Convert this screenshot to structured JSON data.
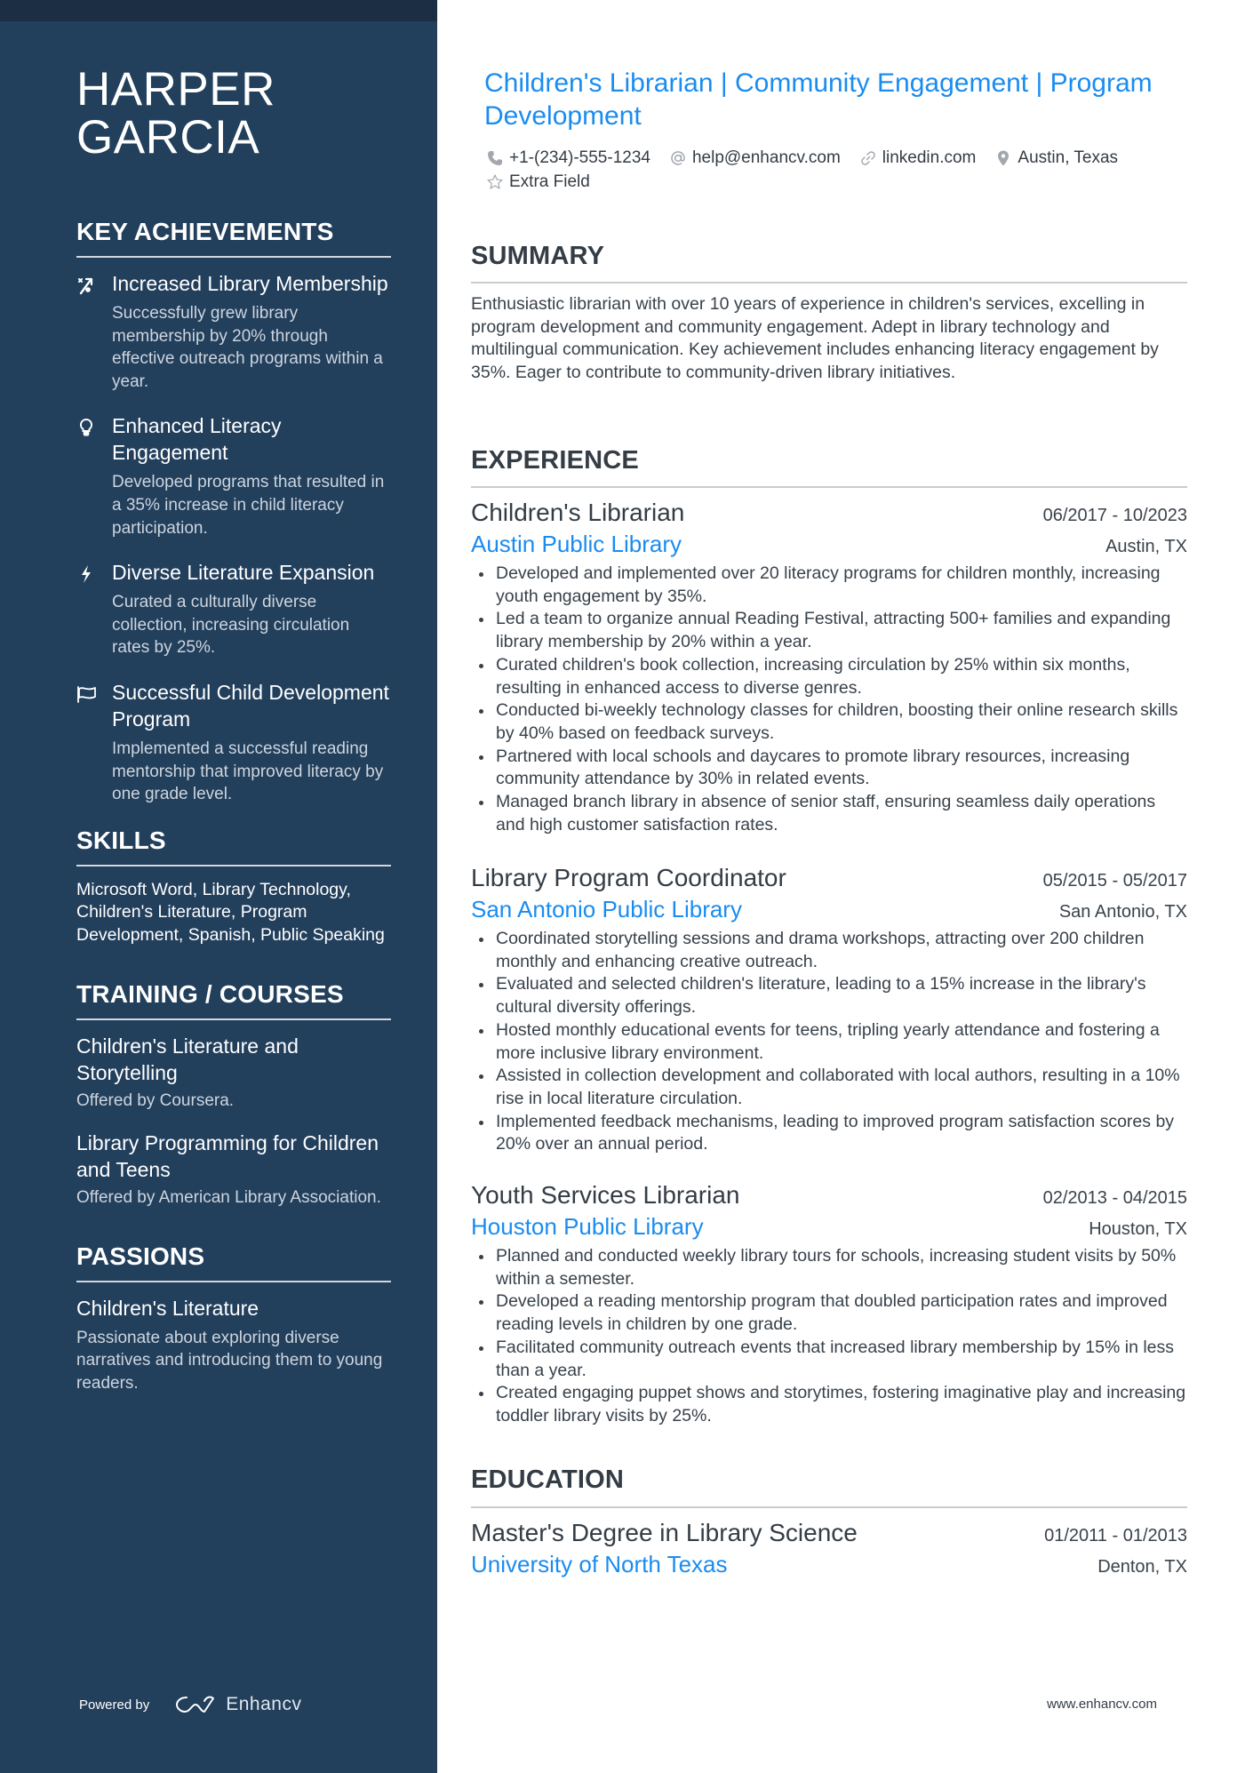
{
  "profile": {
    "first_name": "HARPER",
    "last_name": "GARCIA",
    "headline": "Children's Librarian | Community Engagement | Program Development"
  },
  "contacts": {
    "phone": "+1-(234)-555-1234",
    "email": "help@enhancv.com",
    "link": "linkedin.com",
    "location": "Austin, Texas",
    "extra": "Extra Field"
  },
  "colors": {
    "sidebar_bg": "#223f5c",
    "sidebar_topbar": "#1c2e44",
    "accent": "#1a8cf0",
    "text": "#343c45"
  },
  "sidebar": {
    "achievements": {
      "heading": "KEY ACHIEVEMENTS",
      "items": [
        {
          "icon": "growth-chart-icon",
          "title": "Increased Library Membership",
          "desc": "Successfully grew library membership by 20% through effective outreach programs within a year."
        },
        {
          "icon": "lightbulb-icon",
          "title": "Enhanced Literacy Engagement",
          "desc": "Developed programs that resulted in a 35% increase in child literacy participation."
        },
        {
          "icon": "lightning-bolt-icon",
          "title": "Diverse Literature Expansion",
          "desc": "Curated a culturally diverse collection, increasing circulation rates by 25%."
        },
        {
          "icon": "flag-icon",
          "title": "Successful Child Development Program",
          "desc": "Implemented a successful reading mentorship that improved literacy by one grade level."
        }
      ]
    },
    "skills": {
      "heading": "SKILLS",
      "text": "Microsoft Word, Library Technology, Children's Literature, Program Development, Spanish, Public Speaking"
    },
    "training": {
      "heading": "TRAINING / COURSES",
      "items": [
        {
          "title": "Children's Literature and Storytelling",
          "desc": "Offered by Coursera."
        },
        {
          "title": "Library Programming for Children and Teens",
          "desc": "Offered by American Library Association."
        }
      ]
    },
    "passions": {
      "heading": "PASSIONS",
      "items": [
        {
          "title": "Children's Literature",
          "desc": "Passionate about exploring diverse narratives and introducing them to young readers."
        }
      ]
    },
    "powered_by": {
      "label": "Powered by",
      "brand": "Enhancv"
    }
  },
  "summary": {
    "heading": "SUMMARY",
    "text": "Enthusiastic librarian with over 10 years of experience in children's services, excelling in program development and community engagement. Adept in library technology and multilingual communication. Key achievement includes enhancing literacy engagement by 35%. Eager to contribute to community-driven library initiatives."
  },
  "experience": {
    "heading": "EXPERIENCE",
    "jobs": [
      {
        "title": "Children's Librarian",
        "dates": "06/2017 - 10/2023",
        "org": "Austin Public Library",
        "location": "Austin, TX",
        "bullets": [
          "Developed and implemented over 20 literacy programs for children monthly, increasing youth engagement by 35%.",
          "Led a team to organize annual Reading Festival, attracting 500+ families and expanding library membership by 20% within a year.",
          "Curated children's book collection, increasing circulation by 25% within six months, resulting in enhanced access to diverse genres.",
          "Conducted bi-weekly technology classes for children, boosting their online research skills by 40% based on feedback surveys.",
          "Partnered with local schools and daycares to promote library resources, increasing community attendance by 30% in related events.",
          "Managed branch library in absence of senior staff, ensuring seamless daily operations and high customer satisfaction rates."
        ]
      },
      {
        "title": "Library Program Coordinator",
        "dates": "05/2015 - 05/2017",
        "org": "San Antonio Public Library",
        "location": "San Antonio, TX",
        "bullets": [
          "Coordinated storytelling sessions and drama workshops, attracting over 200 children monthly and enhancing creative outreach.",
          "Evaluated and selected children's literature, leading to a 15% increase in the library's cultural diversity offerings.",
          "Hosted monthly educational events for teens, tripling yearly attendance and fostering a more inclusive library environment.",
          "Assisted in collection development and collaborated with local authors, resulting in a 10% rise in local literature circulation.",
          "Implemented feedback mechanisms, leading to improved program satisfaction scores by 20% over an annual period."
        ]
      },
      {
        "title": "Youth Services Librarian",
        "dates": "02/2013 - 04/2015",
        "org": "Houston Public Library",
        "location": "Houston, TX",
        "bullets": [
          "Planned and conducted weekly library tours for schools, increasing student visits by 50% within a semester.",
          "Developed a reading mentorship program that doubled participation rates and improved reading levels in children by one grade.",
          "Facilitated community outreach events that increased library membership by 15% in less than a year.",
          "Created engaging puppet shows and storytimes, fostering imaginative play and increasing toddler library visits by 25%."
        ]
      }
    ]
  },
  "education": {
    "heading": "EDUCATION",
    "items": [
      {
        "degree": "Master's Degree in Library Science",
        "dates": "01/2011 - 01/2013",
        "school": "University of North Texas",
        "location": "Denton, TX"
      }
    ]
  },
  "footer": {
    "url": "www.enhancv.com"
  }
}
